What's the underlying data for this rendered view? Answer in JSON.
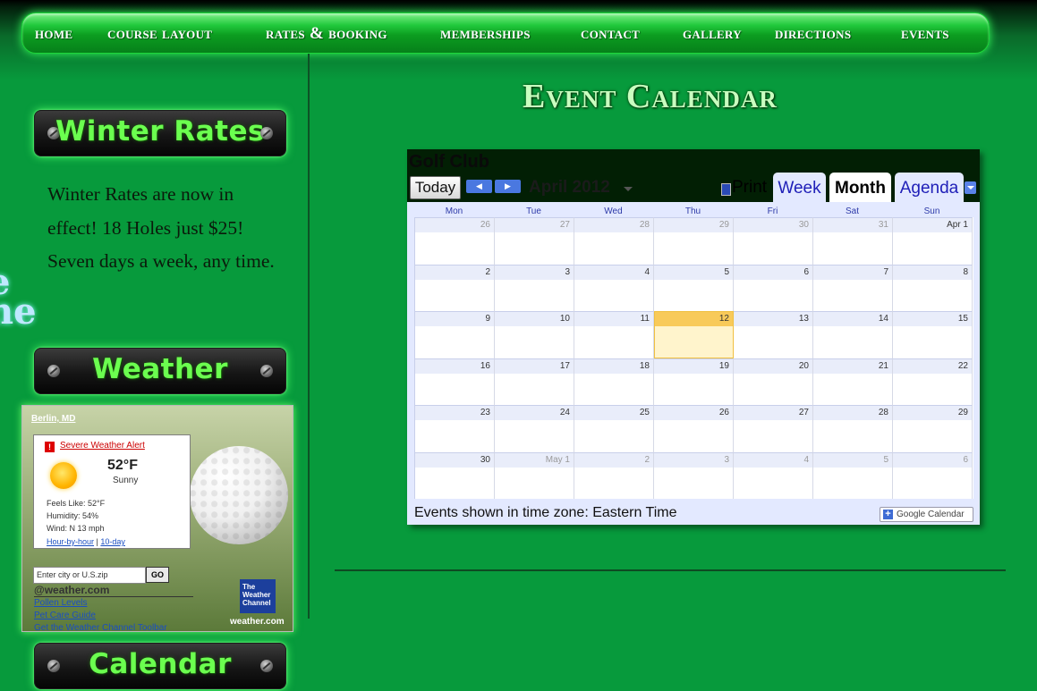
{
  "nav": [
    "Home",
    "Course Layout",
    "Rates & Booking",
    "Memberships",
    "Contact",
    "Gallery",
    "Directions",
    "Events"
  ],
  "sections": {
    "winter": "Winter Rates",
    "weather": "Weather",
    "calendar": "Calendar"
  },
  "winter_text": "Winter Rates are now in effect! 18 Holes just $25! Seven days a week, any time.",
  "edge_glyphs": [
    "e",
    "ne"
  ],
  "weather": {
    "location": "Berlin, MD",
    "alert": "Severe Weather Alert",
    "alert_icon": "!",
    "temp": "52°F",
    "condition": "Sunny",
    "feels_like": "Feels Like: 52°F",
    "humidity": "Humidity: 54%",
    "wind": "Wind: N 13 mph",
    "link_hourly": "Hour-by-hour",
    "link_sep": "|",
    "link_10day": "10-day",
    "zip_placeholder": "Enter city or U.S.zip",
    "go": "GO",
    "brand": "@weather.com",
    "links": [
      "Pollen Levels",
      "Pet Care Guide",
      "Get the Weather Channel Toolbar"
    ],
    "twc_logo": "The Weather Channel",
    "site": "weather.com"
  },
  "event_title": "Event Calendar",
  "calendar": {
    "title": "Golf Club",
    "today": "Today",
    "prev_icon": "◀",
    "next_icon": "▶",
    "month": "April 2012",
    "print": "Print",
    "tabs": [
      "Week",
      "Month",
      "Agenda"
    ],
    "active_tab": "Month",
    "days": [
      "Mon",
      "Tue",
      "Wed",
      "Thu",
      "Fri",
      "Sat",
      "Sun"
    ],
    "weeks": [
      [
        "26",
        "27",
        "28",
        "29",
        "30",
        "31",
        "Apr 1"
      ],
      [
        "2",
        "3",
        "4",
        "5",
        "6",
        "7",
        "8"
      ],
      [
        "9",
        "10",
        "11",
        "12",
        "13",
        "14",
        "15"
      ],
      [
        "16",
        "17",
        "18",
        "19",
        "20",
        "21",
        "22"
      ],
      [
        "23",
        "24",
        "25",
        "26",
        "27",
        "28",
        "29"
      ],
      [
        "30",
        "May 1",
        "2",
        "3",
        "4",
        "5",
        "6"
      ]
    ],
    "other_month": [
      [
        0,
        0
      ],
      [
        0,
        1
      ],
      [
        0,
        2
      ],
      [
        0,
        3
      ],
      [
        0,
        4
      ],
      [
        0,
        5
      ],
      [
        5,
        1
      ],
      [
        5,
        2
      ],
      [
        5,
        3
      ],
      [
        5,
        4
      ],
      [
        5,
        5
      ],
      [
        5,
        6
      ]
    ],
    "today_cell": [
      2,
      3
    ],
    "timezone": "Events shown in time zone: Eastern Time",
    "gcal_label": "Google Calendar",
    "gcal_plus": "+"
  }
}
